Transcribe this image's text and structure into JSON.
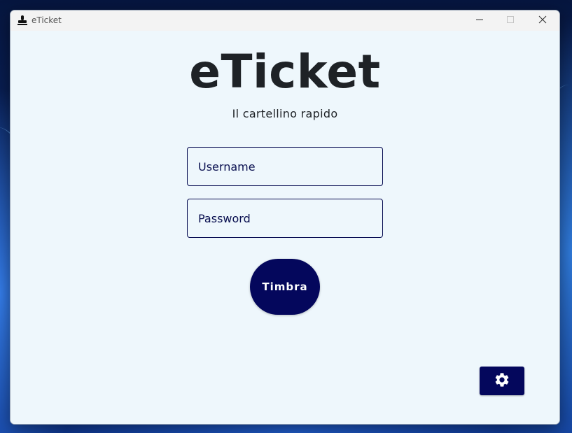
{
  "window": {
    "title": "eTicket",
    "controls": {
      "minimize_icon": "minimize-icon",
      "maximize_icon": "maximize-icon",
      "close_icon": "close-icon"
    }
  },
  "app": {
    "title": "eTicket",
    "subtitle": "Il cartellino rapido"
  },
  "form": {
    "username": {
      "value": "",
      "placeholder": "Username"
    },
    "password": {
      "value": "",
      "placeholder": "Password"
    },
    "submit_label": "Timbra"
  },
  "settings": {
    "icon": "gear-icon"
  },
  "colors": {
    "primary": "#04075c",
    "background": "#eef7fc",
    "text": "#1e2226"
  }
}
